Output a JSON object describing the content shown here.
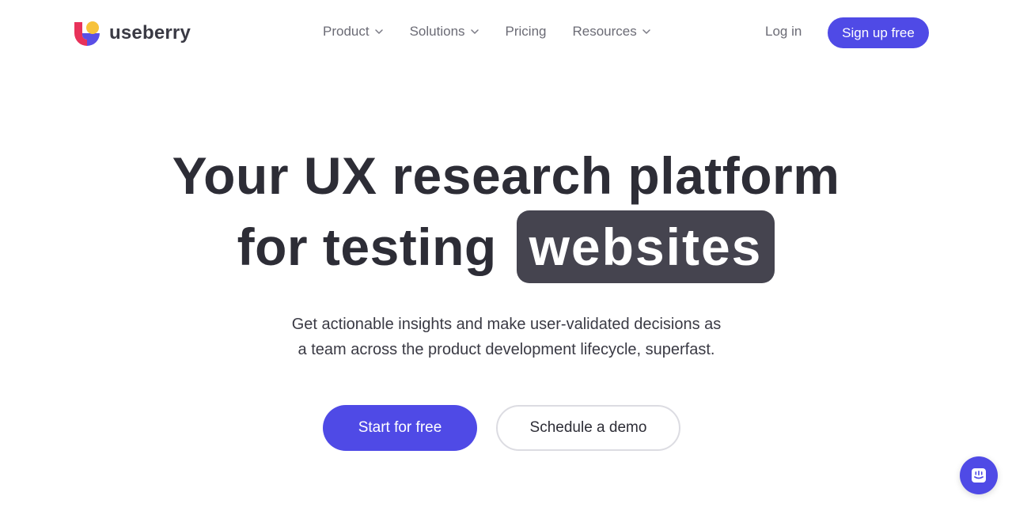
{
  "brand": {
    "name": "useberry",
    "logo_icon": "useberry-logo-icon",
    "colors": {
      "primary": "#4f4ae6",
      "logo_red": "#e8325a",
      "logo_purple": "#5a4ee6",
      "logo_yellow": "#f7c23a",
      "highlight_bg": "#45444f"
    }
  },
  "nav": {
    "items": [
      {
        "label": "Product",
        "has_dropdown": true
      },
      {
        "label": "Solutions",
        "has_dropdown": true
      },
      {
        "label": "Pricing",
        "has_dropdown": false
      },
      {
        "label": "Resources",
        "has_dropdown": true
      }
    ],
    "login_label": "Log in",
    "signup_label": "Sign up free"
  },
  "hero": {
    "title_line1": "Your UX research platform",
    "title_line2_prefix": "for testing",
    "title_highlight": "websites",
    "subtitle_line1": "Get actionable insights and make user-validated decisions as",
    "subtitle_line2": "a team across the product development lifecycle, superfast.",
    "primary_cta": "Start for free",
    "secondary_cta": "Schedule a demo"
  },
  "chat": {
    "icon": "chat-icon"
  }
}
